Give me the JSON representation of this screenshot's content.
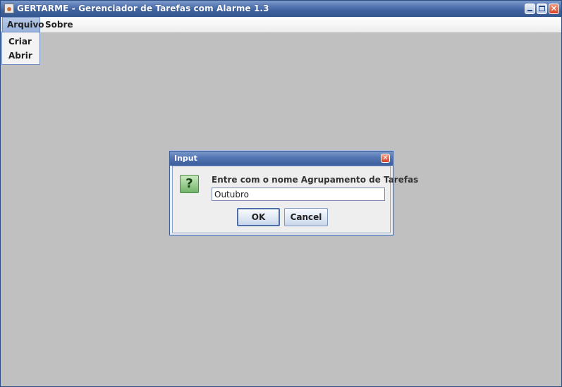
{
  "window": {
    "title": "GERTARME - Gerenciador de Tarefas com Alarme 1.3",
    "controls": {
      "minimize": "minimize-icon",
      "maximize": "maximize-icon",
      "close": "close-icon"
    }
  },
  "menubar": {
    "items": [
      {
        "label": "Arquivo"
      },
      {
        "label": "Sobre"
      }
    ]
  },
  "dropdown": {
    "items": [
      {
        "label": "Criar"
      },
      {
        "label": "Abrir"
      }
    ]
  },
  "dialog": {
    "title": "Input",
    "icon": "question-icon",
    "icon_glyph": "?",
    "message": "Entre com o nome Agrupamento de Tarefas",
    "input_value": "Outubro",
    "ok_label": "OK",
    "cancel_label": "Cancel"
  },
  "colors": {
    "titlebar": "#3f629f",
    "background": "#c0c0c0",
    "accent": "#6f8fc4"
  }
}
